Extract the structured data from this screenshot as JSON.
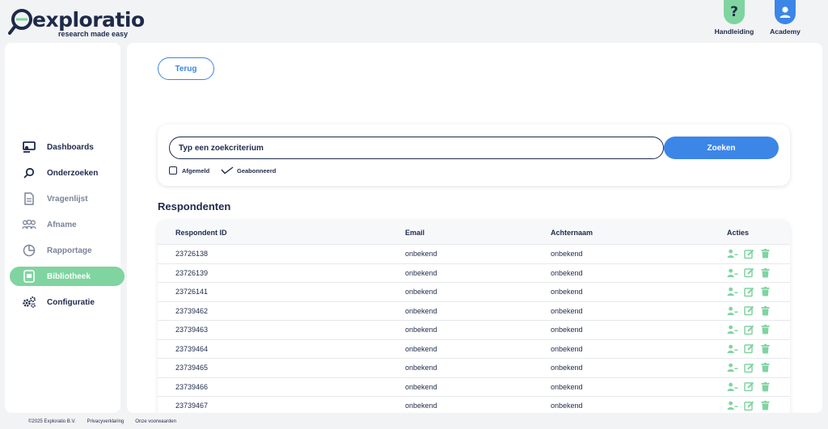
{
  "brand": {
    "name": "exploratio",
    "tagline": "research made easy",
    "color_primary": "#1e2a4a",
    "color_green": "#7fd4a0",
    "color_blue": "#3c86e8"
  },
  "header": {
    "help": {
      "label": "Handleiding",
      "icon": "question-icon"
    },
    "academy": {
      "label": "Academy",
      "icon": "user-icon"
    }
  },
  "sidebar": {
    "items": [
      {
        "label": "Dashboards",
        "icon": "dashboard-icon"
      },
      {
        "label": "Onderzoeken",
        "icon": "search-icon"
      },
      {
        "label": "Vragenlijst",
        "icon": "document-icon"
      },
      {
        "label": "Afname",
        "icon": "people-icon"
      },
      {
        "label": "Rapportage",
        "icon": "pie-chart-icon"
      },
      {
        "label": "Bibliotheek",
        "icon": "library-icon",
        "active": true
      },
      {
        "label": "Configuratie",
        "icon": "gears-icon"
      }
    ]
  },
  "main": {
    "back_label": "Terug",
    "search": {
      "placeholder": "Typ een zoekcriterium",
      "button_label": "Zoeken",
      "filters": [
        {
          "label": "Afgemeld",
          "checked": false
        },
        {
          "label": "Geabonneerd",
          "checked": true
        }
      ]
    },
    "section_title": "Respondenten",
    "table": {
      "headers": [
        "Respondent ID",
        "Email",
        "Achternaam",
        "Acties"
      ],
      "rows": [
        {
          "id": "23726138",
          "email": "onbekend",
          "achternaam": "onbekend"
        },
        {
          "id": "23726139",
          "email": "onbekend",
          "achternaam": "onbekend"
        },
        {
          "id": "23726141",
          "email": "onbekend",
          "achternaam": "onbekend"
        },
        {
          "id": "23739462",
          "email": "onbekend",
          "achternaam": "onbekend"
        },
        {
          "id": "23739463",
          "email": "onbekend",
          "achternaam": "onbekend"
        },
        {
          "id": "23739464",
          "email": "onbekend",
          "achternaam": "onbekend"
        },
        {
          "id": "23739465",
          "email": "onbekend",
          "achternaam": "onbekend"
        },
        {
          "id": "23739466",
          "email": "onbekend",
          "achternaam": "onbekend"
        },
        {
          "id": "23739467",
          "email": "onbekend",
          "achternaam": "onbekend"
        }
      ],
      "actions": [
        "remove-user-icon",
        "edit-icon",
        "trash-icon"
      ]
    }
  },
  "footer": {
    "copyright": "©2025 Exploratio B.V.",
    "privacy": "Privacyverklaring",
    "terms": "Onze voorwaarden"
  }
}
